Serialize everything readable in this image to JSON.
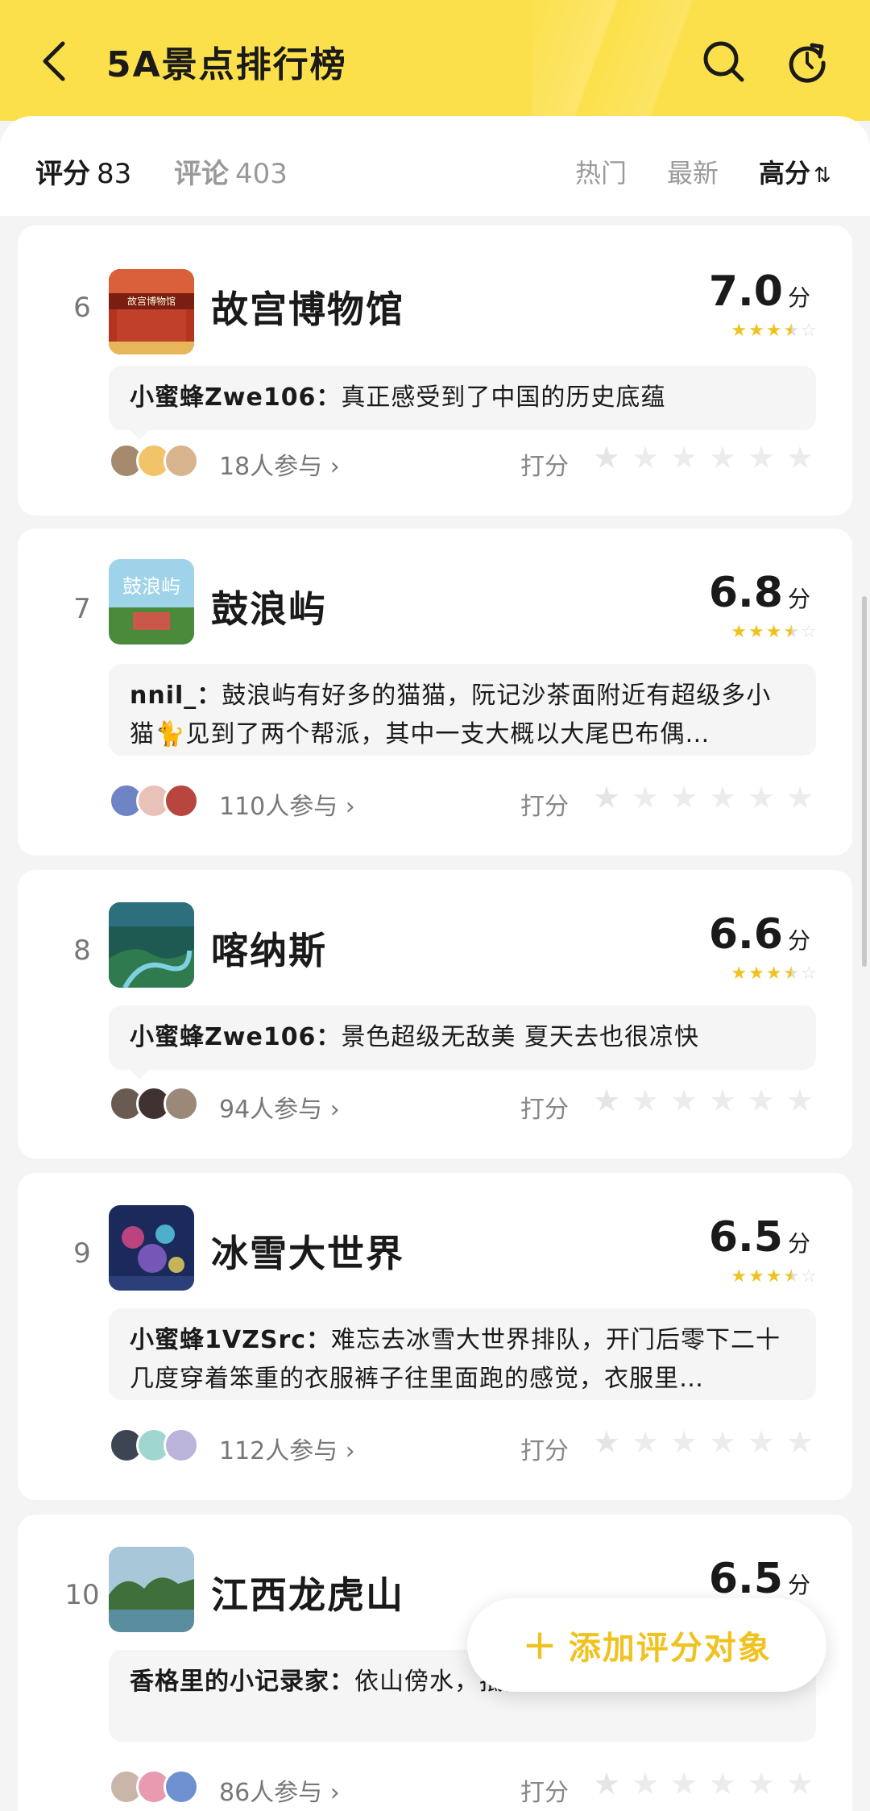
{
  "header": {
    "title": "5A景点排行榜",
    "back_icon": "chevron-left-icon",
    "search_icon": "search-icon",
    "refresh_icon": "refresh-icon",
    "background": "#fce04b"
  },
  "filter": {
    "score_label": "评分",
    "score_count": "83",
    "comment_label": "评论",
    "comment_count": "403",
    "sort_options": [
      "热门",
      "最新",
      "高分"
    ],
    "active_sort": "高分",
    "active_sort_icon": "⇅"
  },
  "rate_label": "打分",
  "score_unit": "分",
  "accent": "#f0c21f",
  "items": [
    {
      "rank": "6",
      "name": "故宫博物馆",
      "score": "7.0",
      "stars": 3.5,
      "comment_user": "小蜜蜂Zwe106：",
      "comment_text": "真正感受到了中国的历史底蕴",
      "participants": "18人参与 ›"
    },
    {
      "rank": "7",
      "name": "鼓浪屿",
      "score": "6.8",
      "stars": 3.5,
      "comment_user": "nnil_：",
      "comment_text": "鼓浪屿有好多的猫猫，阮记沙茶面附近有超级多小猫🐈见到了两个帮派，其中一支大概以大尾巴布偶…",
      "participants": "110人参与 ›"
    },
    {
      "rank": "8",
      "name": "喀纳斯",
      "score": "6.6",
      "stars": 3.5,
      "comment_user": "小蜜蜂Zwe106：",
      "comment_text": "景色超级无敌美 夏天去也很凉快",
      "participants": "94人参与 ›"
    },
    {
      "rank": "9",
      "name": "冰雪大世界",
      "score": "6.5",
      "stars": 3.5,
      "comment_user": "小蜜蜂1VZSrc：",
      "comment_text": "难忘去冰雪大世界排队，开门后零下二十几度穿着笨重的衣服裤子往里面跑的感觉，衣服里…",
      "participants": "112人参与 ›"
    },
    {
      "rank": "10",
      "name": "江西龙虎山",
      "score": "6.5",
      "stars": 3.5,
      "comment_user": "香格里的小记录家：",
      "comment_text": "依山傍水，抵抗力",
      "participants": "86人参与 ›"
    }
  ],
  "fab": {
    "icon": "plus-icon",
    "label": "添加评分对象"
  }
}
